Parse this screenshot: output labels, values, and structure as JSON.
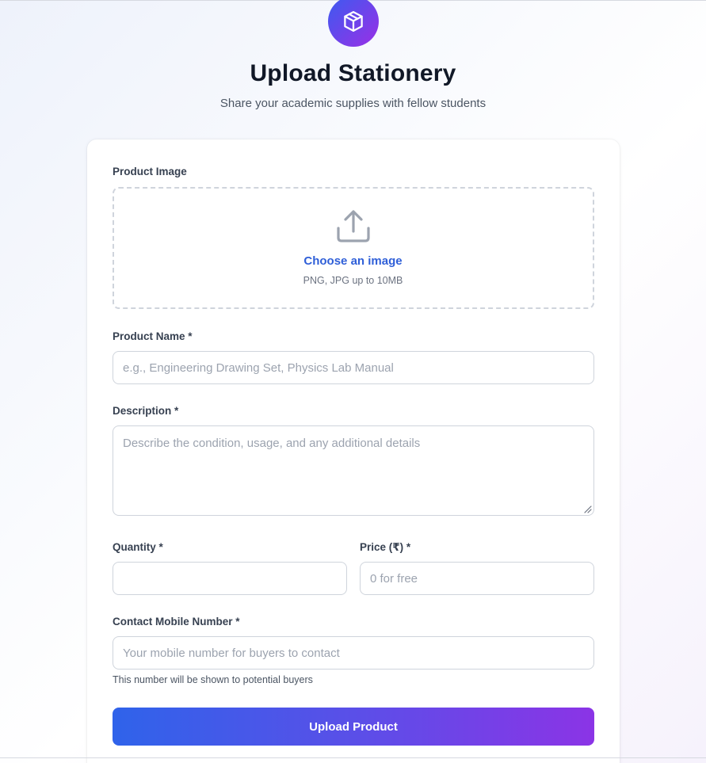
{
  "header": {
    "logo_icon": "package-icon",
    "title": "Upload Stationery",
    "subtitle": "Share your academic supplies with fellow students"
  },
  "form": {
    "image": {
      "label": "Product Image",
      "icon": "upload-icon",
      "choose_text": "Choose an image",
      "hint": "PNG, JPG up to 10MB"
    },
    "name": {
      "label": "Product Name *",
      "value": "",
      "placeholder": "e.g., Engineering Drawing Set, Physics Lab Manual"
    },
    "description": {
      "label": "Description *",
      "value": "",
      "placeholder": "Describe the condition, usage, and any additional details"
    },
    "quantity": {
      "label": "Quantity *",
      "value": "",
      "placeholder": ""
    },
    "price": {
      "label": "Price (₹) *",
      "value": "",
      "placeholder": "0 for free"
    },
    "contact": {
      "label": "Contact Mobile Number *",
      "value": "",
      "placeholder": "Your mobile number for buyers to contact",
      "hint": "This number will be shown to potential buyers"
    },
    "submit_label": "Upload Product"
  },
  "colors": {
    "accent_start": "#2f63ea",
    "accent_end": "#8b34e6",
    "link": "#2f5fd8"
  }
}
